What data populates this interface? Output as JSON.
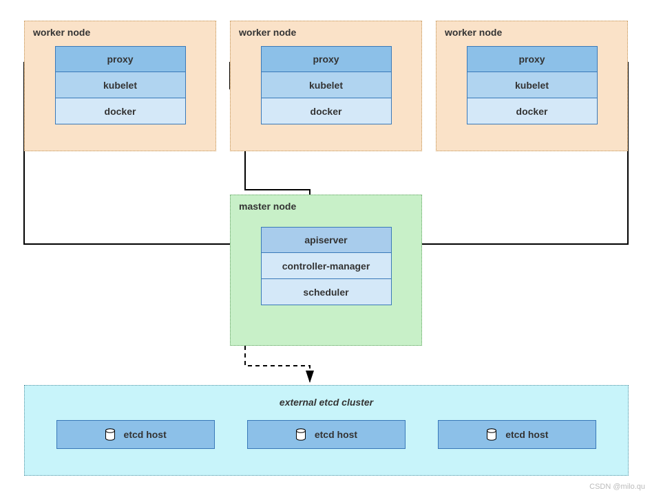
{
  "workers": [
    {
      "title": "worker node",
      "components": [
        "proxy",
        "kubelet",
        "docker"
      ]
    },
    {
      "title": "worker node",
      "components": [
        "proxy",
        "kubelet",
        "docker"
      ]
    },
    {
      "title": "worker node",
      "components": [
        "proxy",
        "kubelet",
        "docker"
      ]
    }
  ],
  "master": {
    "title": "master node",
    "components": [
      "apiserver",
      "controller-manager",
      "scheduler"
    ]
  },
  "etcd": {
    "title": "external etcd cluster",
    "hosts": [
      "etcd host",
      "etcd host",
      "etcd host"
    ]
  },
  "watermark": "CSDN @milo.qu"
}
